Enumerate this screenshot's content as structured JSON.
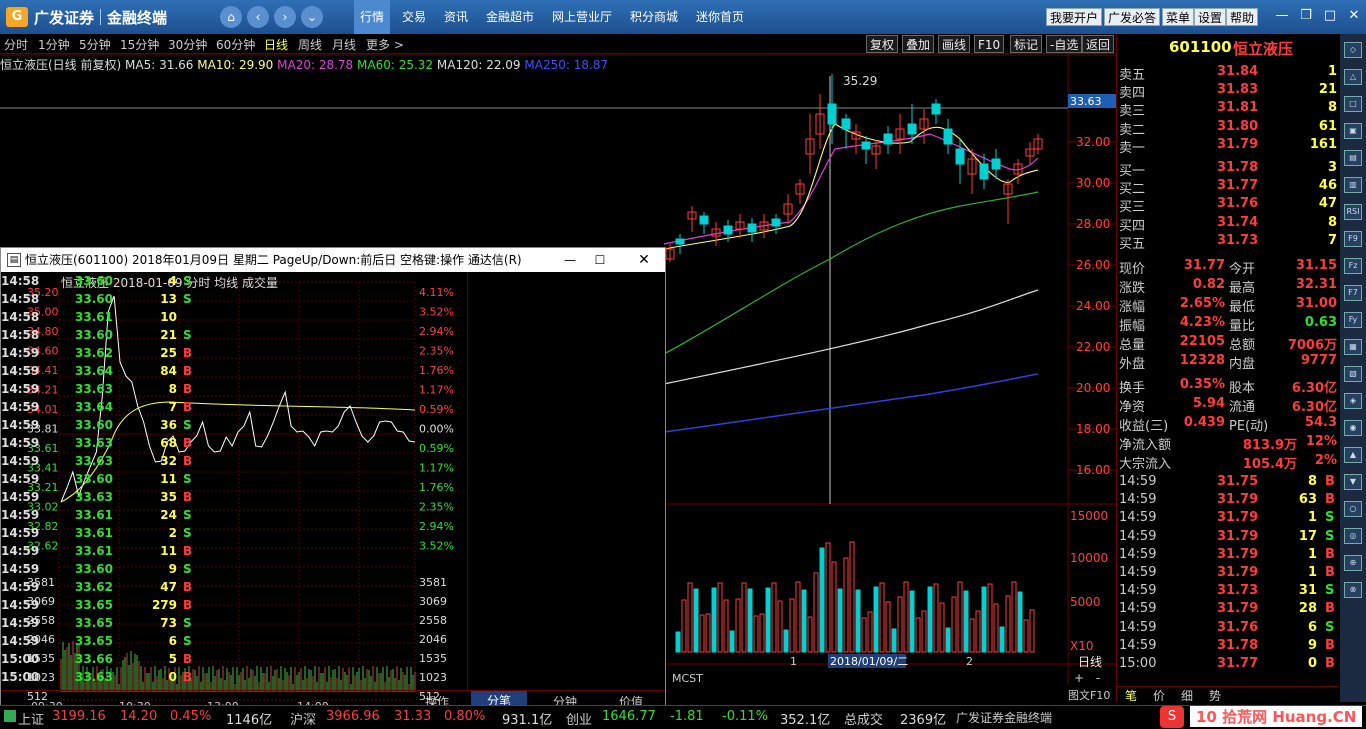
{
  "app": {
    "logo": "广发证券",
    "product": "金融终端",
    "nav_home": "⌂",
    "nav_back": "‹",
    "nav_fwd": "›",
    "nav_more": "⌄"
  },
  "top_tabs": [
    "行情",
    "交易",
    "资讯",
    "金融超市",
    "网上营业厅",
    "积分商城",
    "迷你首页"
  ],
  "top_right_buttons": [
    "我要开户",
    "广发必答",
    "菜单",
    "设置",
    "帮助"
  ],
  "periods": [
    "分时",
    "1分钟",
    "5分钟",
    "15分钟",
    "30分钟",
    "60分钟",
    "日线",
    "周线",
    "月线",
    "更多 >"
  ],
  "tool_buttons": [
    "复权",
    "叠加",
    "画线",
    "F10",
    "标记",
    "-自选",
    "返回"
  ],
  "info": {
    "name": "恒立液压(日线 前复权)",
    "ma5": "MA5: 31.66",
    "ma10": "MA10: 29.90",
    "ma20": "MA20: 28.78",
    "ma60": "MA60: 25.32",
    "ma120": "MA120: 22.09",
    "ma250": "MA250: 18.87"
  },
  "price_axis": [
    "33.63",
    "32.00",
    "30.00",
    "28.00",
    "26.00",
    "24.00",
    "22.00",
    "20.00",
    "18.00",
    "16.00"
  ],
  "vol_axis": [
    "15000",
    "10000",
    "5000",
    "X10"
  ],
  "peak_label": "35.29",
  "date_label": "2018/01/09/二",
  "x_marks": [
    "1",
    "2"
  ],
  "bottom_tags": {
    "mcst": "MCST",
    "daily": "日线",
    "nav_l": "+",
    "nav_r": "-",
    "f10": "图文F10"
  },
  "right": {
    "code": "601100",
    "name": "恒立液压",
    "asks": [
      {
        "l": "卖五",
        "p": "31.84",
        "v": "1"
      },
      {
        "l": "卖四",
        "p": "31.83",
        "v": "21"
      },
      {
        "l": "卖三",
        "p": "31.81",
        "v": "8"
      },
      {
        "l": "卖二",
        "p": "31.80",
        "v": "61"
      },
      {
        "l": "卖一",
        "p": "31.79",
        "v": "161"
      }
    ],
    "bids": [
      {
        "l": "买一",
        "p": "31.78",
        "v": "3"
      },
      {
        "l": "买二",
        "p": "31.77",
        "v": "46"
      },
      {
        "l": "买三",
        "p": "31.76",
        "v": "47"
      },
      {
        "l": "买四",
        "p": "31.74",
        "v": "8"
      },
      {
        "l": "买五",
        "p": "31.73",
        "v": "7"
      }
    ],
    "stats": [
      {
        "a": "现价",
        "av": "31.77",
        "b": "今开",
        "bv": "31.15"
      },
      {
        "a": "涨跌",
        "av": "0.82",
        "b": "最高",
        "bv": "32.31"
      },
      {
        "a": "涨幅",
        "av": "2.65%",
        "b": "最低",
        "bv": "31.00"
      },
      {
        "a": "振幅",
        "av": "4.23%",
        "b": "量比",
        "bv": "0.63"
      },
      {
        "a": "总量",
        "av": "22105",
        "b": "总额",
        "bv": "7006万"
      },
      {
        "a": "外盘",
        "av": "12328",
        "b": "内盘",
        "bv": "9777"
      },
      {
        "a": "换手",
        "av": "0.35%",
        "b": "股本",
        "bv": "6.30亿"
      },
      {
        "a": "净资",
        "av": "5.94",
        "b": "流通",
        "bv": "6.30亿"
      },
      {
        "a": "收益(三)",
        "av": "0.439",
        "b": "PE(动)",
        "bv": "54.3"
      }
    ],
    "flows": [
      {
        "l": "净流入额",
        "v": "813.9万",
        "p": "12%"
      },
      {
        "l": "大宗流入",
        "v": "105.4万",
        "p": "2%"
      }
    ],
    "ticks": [
      {
        "t": "14:59",
        "p": "31.75",
        "v": "8",
        "d": "B"
      },
      {
        "t": "14:59",
        "p": "31.79",
        "v": "63",
        "d": "B"
      },
      {
        "t": "14:59",
        "p": "31.79",
        "v": "1",
        "d": "S"
      },
      {
        "t": "14:59",
        "p": "31.79",
        "v": "17",
        "d": "S"
      },
      {
        "t": "14:59",
        "p": "31.79",
        "v": "1",
        "d": "B"
      },
      {
        "t": "14:59",
        "p": "31.79",
        "v": "1",
        "d": "B"
      },
      {
        "t": "14:59",
        "p": "31.73",
        "v": "31",
        "d": "S"
      },
      {
        "t": "14:59",
        "p": "31.79",
        "v": "28",
        "d": "B"
      },
      {
        "t": "14:59",
        "p": "31.76",
        "v": "6",
        "d": "S"
      },
      {
        "t": "14:59",
        "p": "31.78",
        "v": "9",
        "d": "B"
      },
      {
        "t": "15:00",
        "p": "31.77",
        "v": "0",
        "d": "B"
      }
    ],
    "bottom_tabs": [
      "笔",
      "价",
      "细",
      "势"
    ]
  },
  "side_icons": [
    "◇",
    "△",
    "□",
    "▣",
    "▤",
    "▥",
    "RSI",
    "F9",
    "Fz",
    "F7",
    "Fy",
    "▦",
    "▧",
    "◈",
    "◉",
    "▲",
    "▼",
    "○",
    "◎",
    "⊕",
    "⊗"
  ],
  "popup": {
    "title": "恒立液压(601100) 2018年01月09日 星期二 PageUp/Down:前后日 空格键:操作 通达信(R)",
    "header": "恒立液压   2018-01-09 分时  均线  成交量",
    "left_axis": [
      "35.20",
      "35.00",
      "34.80",
      "34.60",
      "34.41",
      "34.21",
      "34.01",
      "33.81",
      "33.61",
      "33.41",
      "33.21",
      "33.02",
      "32.82",
      "32.62",
      "3581",
      "3069",
      "2558",
      "2046",
      "1535",
      "1023",
      "512"
    ],
    "right_axis": [
      "4.11%",
      "3.52%",
      "2.94%",
      "2.35%",
      "1.76%",
      "1.17%",
      "0.59%",
      "0.00%",
      "0.59%",
      "1.17%",
      "1.76%",
      "2.35%",
      "2.94%",
      "3.52%",
      "3581",
      "3069",
      "2558",
      "2046",
      "1535",
      "1023",
      "512"
    ],
    "time_axis": [
      "09:30",
      "10:30",
      "13:00",
      "14:00"
    ],
    "ticks": [
      {
        "t": "14:58",
        "p": "33.60",
        "v": "4",
        "d": "S"
      },
      {
        "t": "14:58",
        "p": "33.60",
        "v": "13",
        "d": "S"
      },
      {
        "t": "14:58",
        "p": "33.61",
        "v": "10",
        "d": ""
      },
      {
        "t": "14:58",
        "p": "33.60",
        "v": "21",
        "d": "S"
      },
      {
        "t": "14:59",
        "p": "33.62",
        "v": "25",
        "d": "B"
      },
      {
        "t": "14:59",
        "p": "33.64",
        "v": "84",
        "d": "B"
      },
      {
        "t": "14:59",
        "p": "33.63",
        "v": "8",
        "d": "B"
      },
      {
        "t": "14:59",
        "p": "33.64",
        "v": "7",
        "d": "B"
      },
      {
        "t": "14:59",
        "p": "33.60",
        "v": "36",
        "d": "S"
      },
      {
        "t": "14:59",
        "p": "33.63",
        "v": "68",
        "d": "B"
      },
      {
        "t": "14:59",
        "p": "33.63",
        "v": "32",
        "d": "B"
      },
      {
        "t": "14:59",
        "p": "33.60",
        "v": "11",
        "d": "S"
      },
      {
        "t": "14:59",
        "p": "33.63",
        "v": "35",
        "d": "B"
      },
      {
        "t": "14:59",
        "p": "33.61",
        "v": "24",
        "d": "S"
      },
      {
        "t": "14:59",
        "p": "33.61",
        "v": "2",
        "d": "S"
      },
      {
        "t": "14:59",
        "p": "33.61",
        "v": "11",
        "d": "B"
      },
      {
        "t": "14:59",
        "p": "33.60",
        "v": "9",
        "d": "S"
      },
      {
        "t": "14:59",
        "p": "33.62",
        "v": "47",
        "d": "B"
      },
      {
        "t": "14:59",
        "p": "33.65",
        "v": "279",
        "d": "B"
      },
      {
        "t": "14:59",
        "p": "33.65",
        "v": "73",
        "d": "S"
      },
      {
        "t": "14:59",
        "p": "33.65",
        "v": "6",
        "d": "S"
      },
      {
        "t": "15:00",
        "p": "33.66",
        "v": "5",
        "d": "B"
      },
      {
        "t": "15:00",
        "p": "33.63",
        "v": "0",
        "d": "B"
      }
    ],
    "bottom_tabs": [
      "操作",
      "分笔",
      "分钟",
      "价值"
    ]
  },
  "status": [
    {
      "l": "上证",
      "v": "3199.16",
      "c": "14.20",
      "p": "0.45%",
      "a": "1146亿"
    },
    {
      "l": "沪深",
      "v": "3966.96",
      "c": "31.33",
      "p": "0.80%",
      "a": "931.1亿"
    },
    {
      "l": "创业",
      "v": "1646.77",
      "c": "-1.81",
      "p": "-0.11%",
      "a": "352.1亿"
    }
  ],
  "status_total": {
    "l": "总成交",
    "v": "2369亿",
    "broker": "广发证券金融终端"
  },
  "watermark": "10 拾荒网 Huang.CN",
  "colors": {
    "up": "#ff3c3c",
    "down": "#00d0d0",
    "yellow": "#ffff50",
    "green": "#30e030"
  }
}
